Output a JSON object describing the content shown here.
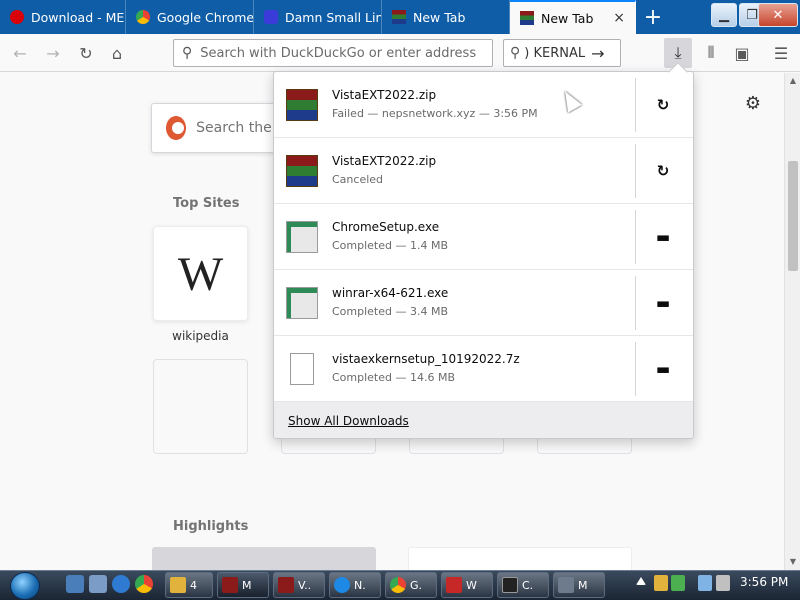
{
  "tabs": [
    {
      "label": "Download - ME",
      "icon": "mega-icon",
      "color": "#d90007"
    },
    {
      "label": "Google Chrome",
      "icon": "chrome-icon",
      "color": "#4285f4"
    },
    {
      "label": "Damn Small Lin",
      "icon": "dsl-icon",
      "color": "#3b3bd9"
    },
    {
      "label": "New Tab",
      "icon": "winrar-icon",
      "color": "#8b1a1a"
    },
    {
      "label": "New Tab",
      "icon": "winrar-icon",
      "color": "#8b1a1a",
      "active": true,
      "close": "×"
    }
  ],
  "window_controls": {
    "minimize": "▁",
    "maximize": "❐",
    "close": "✕"
  },
  "newtab_label": "+",
  "nav": {
    "back": "←",
    "forward": "→",
    "reload": "↻",
    "home": "⌂",
    "url_placeholder": "Search with DuckDuckGo or enter address",
    "search_text": ") KERNAL",
    "search_go": "→",
    "downloads_icon": "⤓",
    "library_icon": "⦀",
    "sidebar_icon": "▣",
    "menu_icon": "☰"
  },
  "page": {
    "search_placeholder": "Search the W",
    "top_sites_title": "Top Sites",
    "highlights_title": "Highlights",
    "top_sites": [
      {
        "label": "wikipedia",
        "glyph": "W"
      }
    ],
    "settings_icon": "⚙"
  },
  "downloads": {
    "items": [
      {
        "name": "VistaEXT2022.zip",
        "status": "Failed — nepsnetwork.xyz — 3:56 PM",
        "icon": "winrar-icon",
        "action": "↻",
        "action_name": "retry-button"
      },
      {
        "name": "VistaEXT2022.zip",
        "status": "Canceled",
        "icon": "winrar-icon",
        "action": "↻",
        "action_name": "retry-button"
      },
      {
        "name": "ChromeSetup.exe",
        "status": "Completed — 1.4 MB",
        "icon": "installer-icon",
        "action": "▬",
        "action_name": "open-folder-button"
      },
      {
        "name": "winrar-x64-621.exe",
        "status": "Completed — 3.4 MB",
        "icon": "installer-icon",
        "action": "▬",
        "action_name": "open-folder-button"
      },
      {
        "name": "vistaexkernsetup_10192022.7z",
        "status": "Completed — 14.6 MB",
        "icon": "file-icon",
        "action": "▬",
        "action_name": "open-folder-button"
      }
    ],
    "footer": "Show All Downloads"
  },
  "taskbar": {
    "buttons": [
      {
        "label": "4",
        "color": "#e2b33c"
      },
      {
        "label": "M",
        "color": "#8b1a1a"
      },
      {
        "label": "V..",
        "color": "#8b1a1a"
      },
      {
        "label": "N.",
        "color": "#1e88e5"
      },
      {
        "label": "G.",
        "color": "#4285f4"
      },
      {
        "label": "W",
        "color": "#c62828"
      },
      {
        "label": "C.",
        "color": "#222222"
      },
      {
        "label": "M",
        "color": "#6d7b8d"
      }
    ],
    "clock": "3:56 PM"
  }
}
